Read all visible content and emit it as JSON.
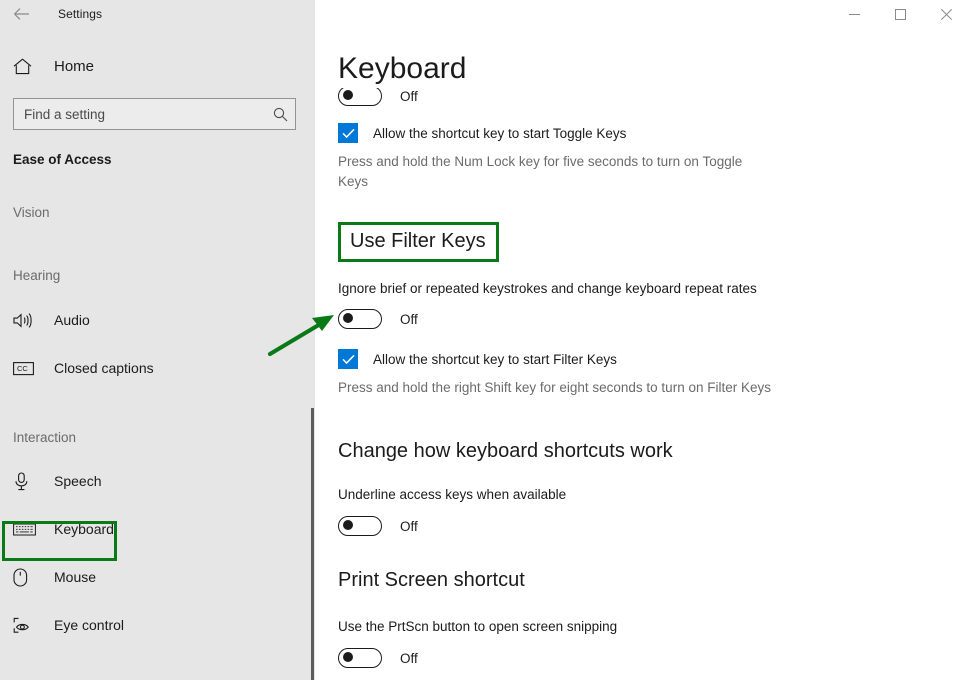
{
  "window": {
    "app_title": "Settings",
    "back_icon": "back-arrow-icon",
    "controls": {
      "minimize": "minimize-icon",
      "maximize": "maximize-icon",
      "close": "close-icon"
    }
  },
  "sidebar": {
    "home_label": "Home",
    "home_icon": "home-icon",
    "search": {
      "placeholder": "Find a setting",
      "value": "",
      "icon": "search-icon"
    },
    "section_title": "Ease of Access",
    "groups": [
      {
        "label": "Vision",
        "items": []
      },
      {
        "label": "Hearing",
        "items": [
          {
            "label": "Audio",
            "icon": "speaker-icon",
            "selected": false
          },
          {
            "label": "Closed captions",
            "icon": "closed-captions-icon",
            "selected": false
          }
        ]
      },
      {
        "label": "Interaction",
        "items": [
          {
            "label": "Speech",
            "icon": "microphone-icon",
            "selected": false
          },
          {
            "label": "Keyboard",
            "icon": "keyboard-icon",
            "selected": true
          },
          {
            "label": "Mouse",
            "icon": "mouse-icon",
            "selected": false
          },
          {
            "label": "Eye control",
            "icon": "eye-control-icon",
            "selected": false
          }
        ]
      }
    ]
  },
  "main": {
    "page_title": "Keyboard",
    "clipped_toggle": {
      "state": "Off"
    },
    "toggle_keys": {
      "checkbox_label": "Allow the shortcut key to start Toggle Keys",
      "checkbox_checked": true,
      "description": "Press and hold the Num Lock key for five seconds to turn on Toggle Keys"
    },
    "filter_keys": {
      "heading": "Use Filter Keys",
      "subtitle": "Ignore brief or repeated keystrokes and change keyboard repeat rates",
      "toggle_state": "Off",
      "checkbox_label": "Allow the shortcut key to start Filter Keys",
      "checkbox_checked": true,
      "description": "Press and hold the right Shift key for eight seconds to turn on Filter Keys"
    },
    "shortcuts": {
      "heading": "Change how keyboard shortcuts work",
      "subtitle": "Underline access keys when available",
      "toggle_state": "Off"
    },
    "print_screen": {
      "heading": "Print Screen shortcut",
      "subtitle": "Use the PrtScn button to open screen snipping",
      "toggle_state": "Off"
    }
  },
  "annotations": {
    "highlight_color": "#0a7a16",
    "arrow_color": "#0a7a16",
    "highlighted_sidebar_item": "Keyboard",
    "highlighted_heading": "Use Filter Keys"
  }
}
